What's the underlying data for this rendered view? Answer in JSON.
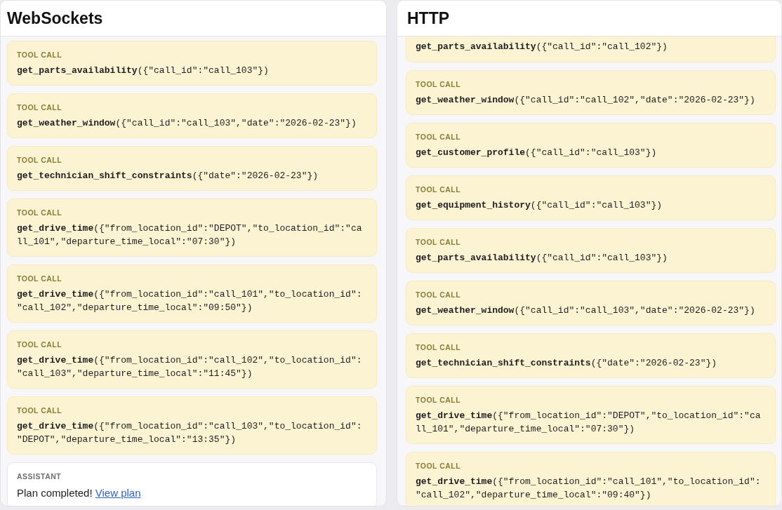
{
  "panels": [
    {
      "title": "WebSockets",
      "messages": [
        {
          "kind": "tool_call",
          "label": "TOOL CALL",
          "text": "**get_parts_availability**({\"call_id\":\"call_103\"})"
        },
        {
          "kind": "tool_call",
          "label": "TOOL CALL",
          "text": "**get_weather_window**({\"call_id\":\"call_103\",\"date\":\"2026-02-23\"})"
        },
        {
          "kind": "tool_call",
          "label": "TOOL CALL",
          "text": "**get_technician_shift_constraints**({\"date\":\"2026-02-23\"})"
        },
        {
          "kind": "tool_call",
          "label": "TOOL CALL",
          "text": "**get_drive_time**({\"from_location_id\":\"DEPOT\",\"to_location_id\":\"call_101\",\"departure_time_local\":\"07:30\"})"
        },
        {
          "kind": "tool_call",
          "label": "TOOL CALL",
          "text": "**get_drive_time**({\"from_location_id\":\"call_101\",\"to_location_id\":\"call_102\",\"departure_time_local\":\"09:50\"})"
        },
        {
          "kind": "tool_call",
          "label": "TOOL CALL",
          "text": "**get_drive_time**({\"from_location_id\":\"call_102\",\"to_location_id\":\"call_103\",\"departure_time_local\":\"11:45\"})"
        },
        {
          "kind": "tool_call",
          "label": "TOOL CALL",
          "text": "**get_drive_time**({\"from_location_id\":\"call_103\",\"to_location_id\":\"DEPOT\",\"departure_time_local\":\"13:35\"})"
        },
        {
          "kind": "assistant",
          "label": "ASSISTANT",
          "text": "Plan completed!",
          "link": "View plan"
        }
      ]
    },
    {
      "title": "HTTP",
      "messages": [
        {
          "kind": "tool_call",
          "text": "**get_parts_availability**({\"call_id\":\"call_102\"})"
        },
        {
          "kind": "tool_call",
          "label": "TOOL CALL",
          "text": "**get_weather_window**({\"call_id\":\"call_102\",\"date\":\"2026-02-23\"})"
        },
        {
          "kind": "tool_call",
          "label": "TOOL CALL",
          "text": "**get_customer_profile**({\"call_id\":\"call_103\"})"
        },
        {
          "kind": "tool_call",
          "label": "TOOL CALL",
          "text": "**get_equipment_history**({\"call_id\":\"call_103\"})"
        },
        {
          "kind": "tool_call",
          "label": "TOOL CALL",
          "text": "**get_parts_availability**({\"call_id\":\"call_103\"})"
        },
        {
          "kind": "tool_call",
          "label": "TOOL CALL",
          "text": "**get_weather_window**({\"call_id\":\"call_103\",\"date\":\"2026-02-23\"})"
        },
        {
          "kind": "tool_call",
          "label": "TOOL CALL",
          "text": "**get_technician_shift_constraints**({\"date\":\"2026-02-23\"})"
        },
        {
          "kind": "tool_call",
          "label": "TOOL CALL",
          "text": "**get_drive_time**({\"from_location_id\":\"DEPOT\",\"to_location_id\":\"call_101\",\"departure_time_local\":\"07:30\"})"
        },
        {
          "kind": "tool_call",
          "label": "TOOL CALL",
          "text": "**get_drive_time**({\"from_location_id\":\"call_101\",\"to_location_id\":\"call_102\",\"departure_time_local\":\"09:40\"})"
        }
      ]
    }
  ]
}
